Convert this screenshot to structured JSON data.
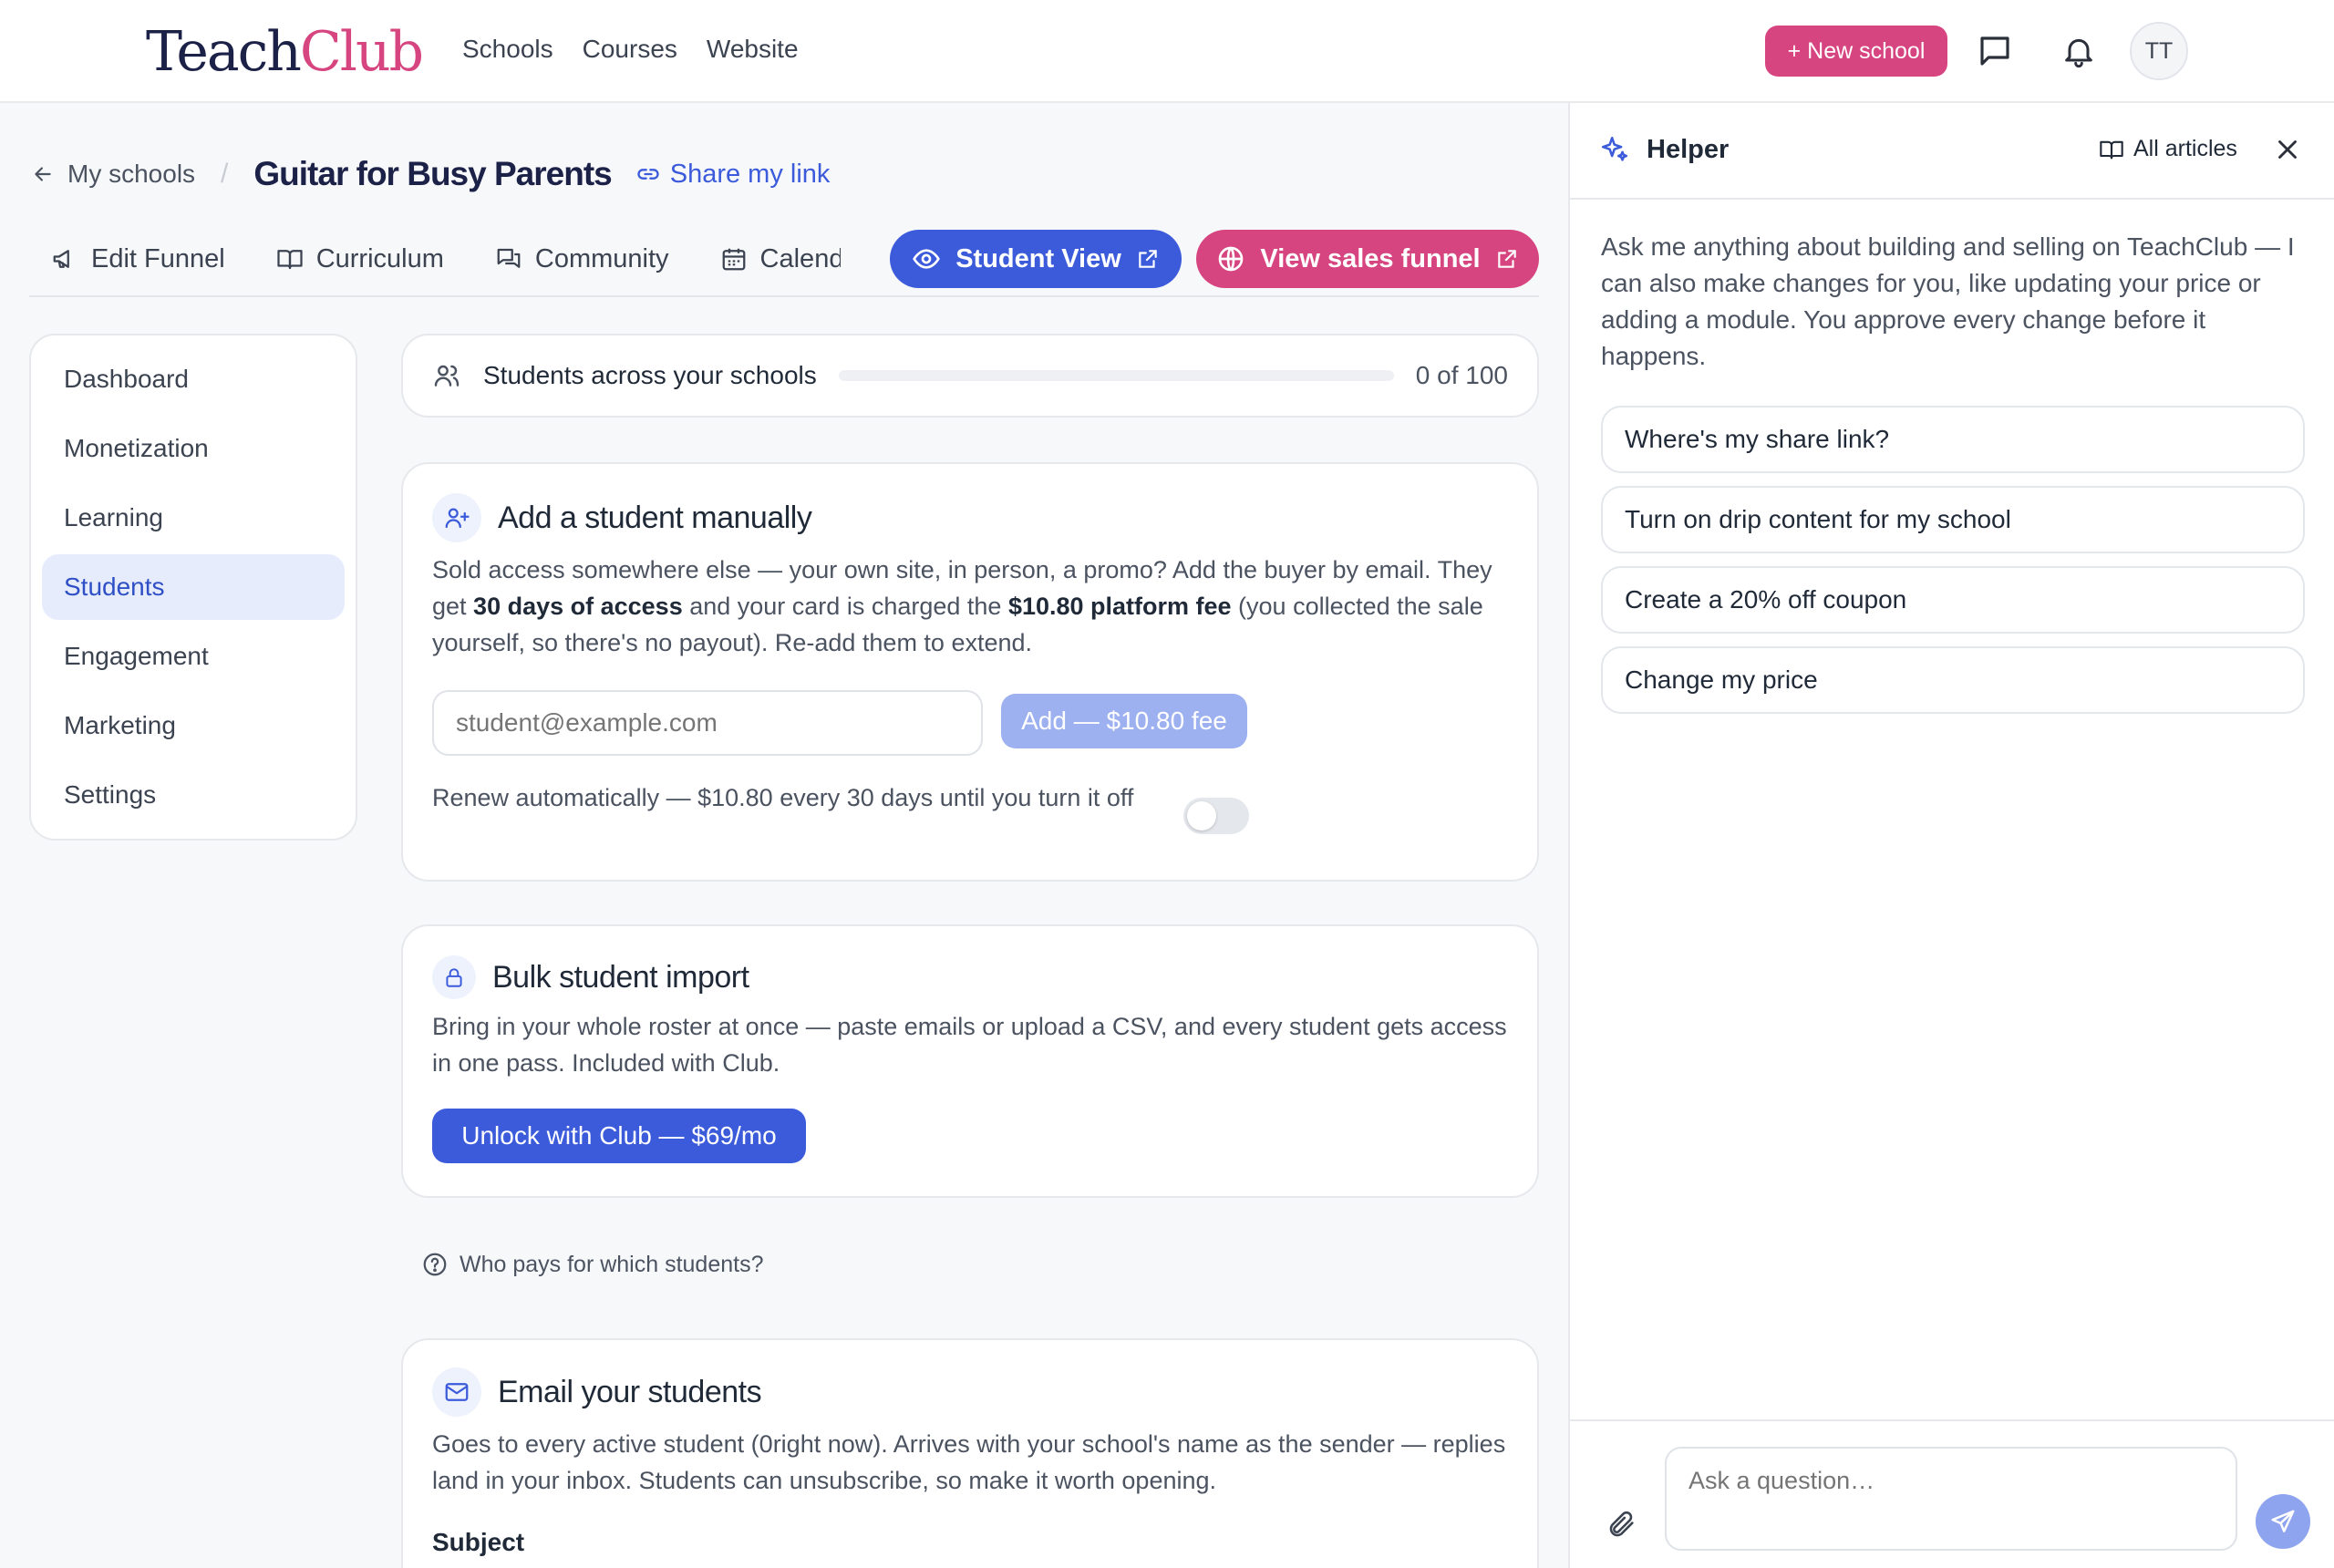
{
  "brand": {
    "part1": "Teach",
    "part2": "Club",
    "accent_color": "#d6457f",
    "primary_color": "#3b5bdb"
  },
  "topnav": {
    "items": [
      "Schools",
      "Courses",
      "Website"
    ]
  },
  "header": {
    "new_school_label": "+ New school",
    "avatar_initials": "TT",
    "chat_icon": "message-square-icon",
    "bell_icon": "bell-icon"
  },
  "breadcrumb": {
    "back_label": "My schools",
    "separator": "/",
    "title": "Guitar for Busy Parents",
    "share_label": "Share my link"
  },
  "tabs": [
    "Edit Funnel",
    "Curriculum",
    "Community",
    "Calendar"
  ],
  "actions": {
    "student_view": "Student View",
    "sales_funnel": "View sales funnel"
  },
  "sidebar": {
    "items": [
      "Dashboard",
      "Monetization",
      "Learning",
      "Students",
      "Engagement",
      "Marketing",
      "Settings"
    ],
    "active": "Students"
  },
  "students_progress": {
    "label": "Students across your schools",
    "count_text": "0 of 100",
    "value": 0,
    "max": 100
  },
  "add_student": {
    "title": "Add a student manually",
    "text_a": "Sold access somewhere else — your own site, in person, a promo? Add the buyer by email. They get ",
    "bold_a": "30 days of access",
    "text_b": " and your card is charged the ",
    "bold_b": "$10.80 platform fee",
    "text_c": " (you collected the sale yourself, so there's no payout). Re-add them to extend.",
    "email_placeholder": "student@example.com",
    "add_button": "Add — $10.80 fee",
    "renew_label": "Renew automatically — $10.80 every 30 days until you turn it off",
    "renew_on": false
  },
  "bulk_import": {
    "title": "Bulk student import",
    "text": "Bring in your whole roster at once — paste emails or upload a CSV, and every student gets access in one pass. Included with Club.",
    "button": "Unlock with Club — $69/mo"
  },
  "help_link": "Who pays for which students?",
  "email_students": {
    "title": "Email your students",
    "text": "Goes to every active student (0right now). Arrives with your school's name as the sender — replies land in your inbox. Students can unsubscribe, so make it worth opening.",
    "subject_label": "Subject"
  },
  "helper": {
    "title": "Helper",
    "all_articles": "All articles",
    "intro": "Ask me anything about building and selling on TeachClub — I can also make changes for you, like updating your price or adding a module. You approve every change before it happens.",
    "suggestions": [
      "Where's my share link?",
      "Turn on drip content for my school",
      "Create a 20% off coupon",
      "Change my price"
    ],
    "ask_placeholder": "Ask a question…"
  }
}
